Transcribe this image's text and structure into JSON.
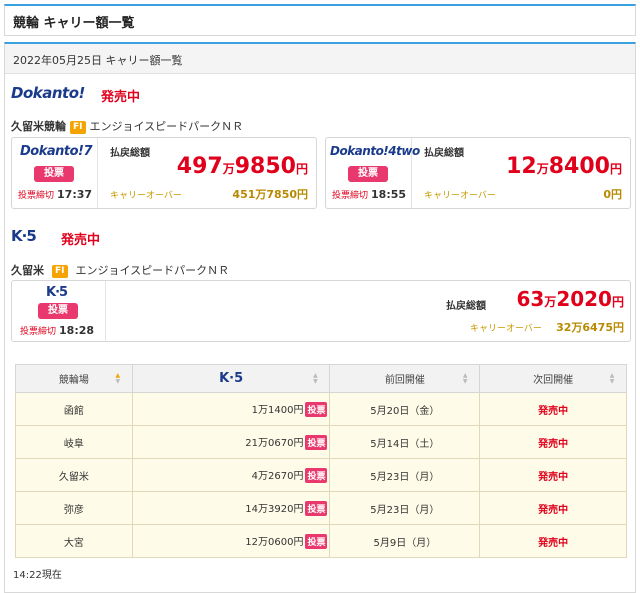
{
  "header": {
    "title": "競輪 キャリー額一覧"
  },
  "date_label": "2022年05月25日 キャリー額一覧",
  "dokanto_section": {
    "logo_text": "Dokanto!",
    "status": "発売中",
    "venue": "久留米競輪",
    "grade": "FI",
    "race_name": "エンジョイスピードパークＮＲ",
    "cards": [
      {
        "logo_text": "Dokanto!7",
        "vote_label": "投票",
        "deadline_label": "投票締切",
        "deadline_time": "17:37",
        "payout_label": "払戻総額",
        "payout_main": "497",
        "payout_man": "万",
        "payout_rest": "9850",
        "payout_yen": "円",
        "carry_label": "キャリーオーバー",
        "carry_value": "451万7850円"
      },
      {
        "logo_text": "Dokanto!4two",
        "vote_label": "投票",
        "deadline_label": "投票締切",
        "deadline_time": "18:55",
        "payout_label": "払戻総額",
        "payout_main": "12",
        "payout_man": "万",
        "payout_rest": "8400",
        "payout_yen": "円",
        "carry_label": "キャリーオーバー",
        "carry_value": "0円"
      }
    ]
  },
  "k5_section": {
    "logo_text": "K·5",
    "status": "発売中",
    "venue": "久留米",
    "grade": "FI",
    "race_name": "エンジョイスピードパークＮＲ",
    "card": {
      "logo_text": "K·5",
      "vote_label": "投票",
      "deadline_label": "投票締切",
      "deadline_time": "18:28",
      "payout_label": "払戻総額",
      "payout_main": "63",
      "payout_man": "万",
      "payout_rest": "2020",
      "payout_yen": "円",
      "carry_label": "キャリーオーバー",
      "carry_value": "32万6475円"
    }
  },
  "table": {
    "headers": [
      "競輪場",
      "K·5",
      "前回開催",
      "次回開催"
    ],
    "vote_label": "投票",
    "rows": [
      {
        "venue": "函館",
        "amount": "1万1400円",
        "prev": "5月20日（金）",
        "next": "発売中"
      },
      {
        "venue": "岐阜",
        "amount": "21万0670円",
        "prev": "5月14日（土）",
        "next": "発売中"
      },
      {
        "venue": "久留米",
        "amount": "4万2670円",
        "prev": "5月23日（月）",
        "next": "発売中"
      },
      {
        "venue": "弥彦",
        "amount": "14万3920円",
        "prev": "5月23日（月）",
        "next": "発売中"
      },
      {
        "venue": "大宮",
        "amount": "12万0600円",
        "prev": "5月9日（月）",
        "next": "発売中"
      }
    ]
  },
  "footer": {
    "now_text": "14:22現在"
  },
  "colors": {
    "accent_blue": "#3aa0e0",
    "sale_red": "#e0001b",
    "vote_pink": "#e8386d",
    "carry_gold": "#b88a00",
    "row_bg": "#fefbe8"
  }
}
